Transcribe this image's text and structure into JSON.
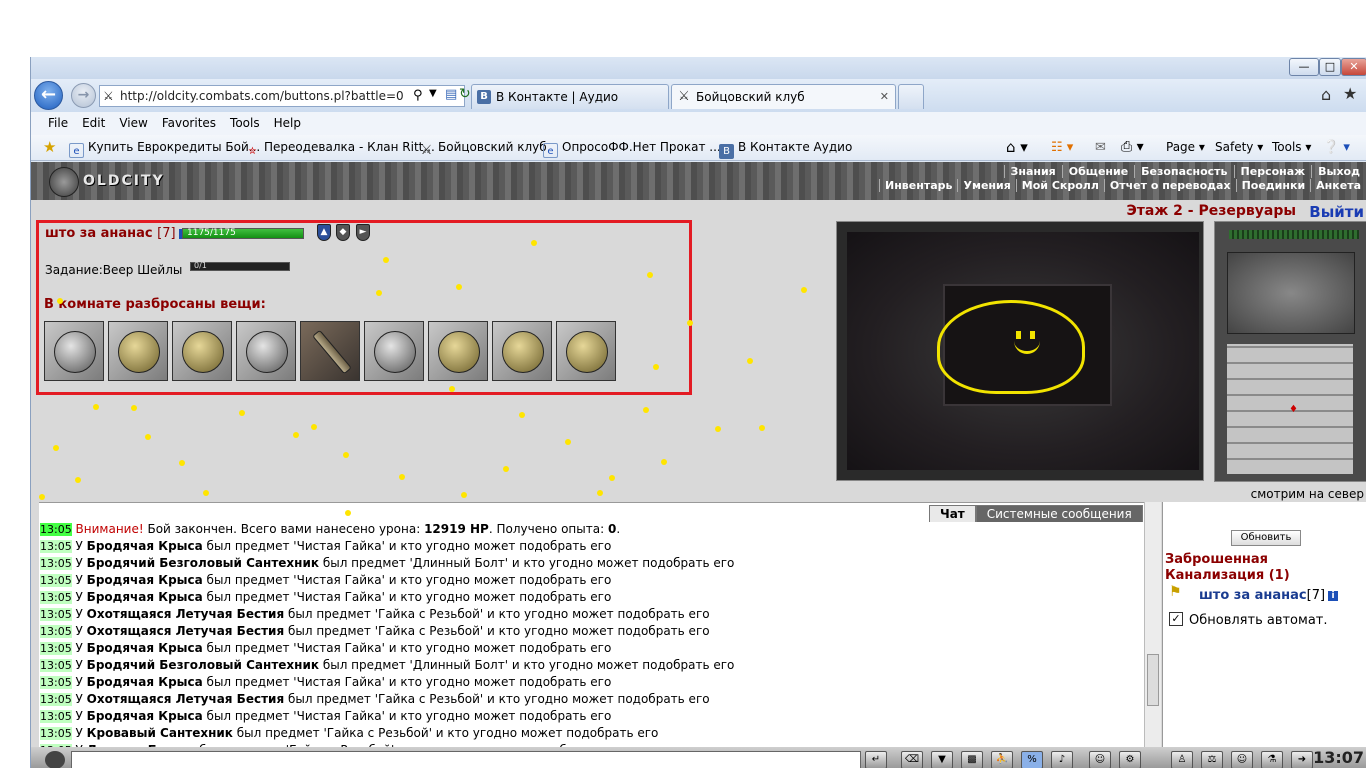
{
  "browser": {
    "address": "http://oldcity.combats.com/buttons.pl?battle=0",
    "tabs": [
      {
        "label": "В Контакте | Аудио",
        "active": false,
        "icon": "vk-icon"
      },
      {
        "label": "Бойцовский клуб",
        "active": true,
        "icon": "swords-icon"
      }
    ],
    "menu": [
      "File",
      "Edit",
      "View",
      "Favorites",
      "Tools",
      "Help"
    ],
    "favorites": [
      {
        "label": "Купить Еврокредиты Бой...",
        "icon": "ie-page-icon"
      },
      {
        "label": "Переодевалка - Клан Ritt...",
        "icon": "clan-icon"
      },
      {
        "label": "Бойцовский клуб",
        "icon": "swords-icon"
      },
      {
        "label": "ОпросоФФ.Нет  Прокат ...",
        "icon": "ie-page-icon"
      },
      {
        "label": "В Контакте  Аудио",
        "icon": "vk-icon"
      }
    ],
    "cmd": {
      "page": "Page",
      "safety": "Safety",
      "tools": "Tools"
    }
  },
  "game": {
    "logo": "OLDCITY",
    "top_menu": [
      "Знания",
      "Общение",
      "Безопасность",
      "Персонаж",
      "Выход"
    ],
    "sub_menu": [
      "Инвентарь",
      "Умения",
      "Мой Скролл",
      "Отчет о переводах",
      "Поединки",
      "Анкета"
    ],
    "player": {
      "name": "што за ананас",
      "level": "[7]",
      "hp_text": "1175/1175",
      "hp_fraction": 1.0
    },
    "task": {
      "label": "Задание:",
      "name": "Веер Шейлы",
      "progress_text": "0/1",
      "progress_fraction": 0
    },
    "loot_header": "В комнате разбросаны вещи:",
    "loot_items": [
      "ring",
      "nut",
      "nut",
      "ring",
      "bolt",
      "ring",
      "nut",
      "nut",
      "nut"
    ],
    "location": "Этаж 2 - Резервуары",
    "exit_label": "Выйти",
    "look_caption": "смотрим на север"
  },
  "chat": {
    "tabs": [
      "Чат",
      "Системные сообщения"
    ],
    "lines": [
      {
        "time": "13:05",
        "alert": true,
        "parts": [
          [
            "r",
            "Внимание!"
          ],
          [
            "n",
            " Бой закончен. Всего вами нанесено урона: "
          ],
          [
            "b",
            "12919 HP"
          ],
          [
            "n",
            ". Получено опыта: "
          ],
          [
            "b",
            "0"
          ],
          [
            "n",
            "."
          ]
        ]
      },
      {
        "time": "13:05",
        "parts": [
          [
            "n",
            "У "
          ],
          [
            "b",
            "Бродячая Крыса"
          ],
          [
            "n",
            " был предмет 'Чистая Гайка' и кто угодно может подобрать его"
          ]
        ]
      },
      {
        "time": "13:05",
        "parts": [
          [
            "n",
            "У "
          ],
          [
            "b",
            "Бродячий Безголовый Сантехник"
          ],
          [
            "n",
            " был предмет 'Длинный Болт' и кто угодно может подобрать его"
          ]
        ]
      },
      {
        "time": "13:05",
        "parts": [
          [
            "n",
            "У "
          ],
          [
            "b",
            "Бродячая Крыса"
          ],
          [
            "n",
            " был предмет 'Чистая Гайка' и кто угодно может подобрать его"
          ]
        ]
      },
      {
        "time": "13:05",
        "parts": [
          [
            "n",
            "У "
          ],
          [
            "b",
            "Бродячая Крыса"
          ],
          [
            "n",
            " был предмет 'Чистая Гайка' и кто угодно может подобрать его"
          ]
        ]
      },
      {
        "time": "13:05",
        "parts": [
          [
            "n",
            "У "
          ],
          [
            "b",
            "Охотящаяся Летучая Бестия"
          ],
          [
            "n",
            " был предмет 'Гайка с Резьбой' и кто угодно может подобрать его"
          ]
        ]
      },
      {
        "time": "13:05",
        "parts": [
          [
            "n",
            "У "
          ],
          [
            "b",
            "Охотящаяся Летучая Бестия"
          ],
          [
            "n",
            " был предмет 'Гайка с Резьбой' и кто угодно может подобрать его"
          ]
        ]
      },
      {
        "time": "13:05",
        "parts": [
          [
            "n",
            "У "
          ],
          [
            "b",
            "Бродячая Крыса"
          ],
          [
            "n",
            " был предмет 'Чистая Гайка' и кто угодно может подобрать его"
          ]
        ]
      },
      {
        "time": "13:05",
        "parts": [
          [
            "n",
            "У "
          ],
          [
            "b",
            "Бродячий Безголовый Сантехник"
          ],
          [
            "n",
            " был предмет 'Длинный Болт' и кто угодно может подобрать его"
          ]
        ]
      },
      {
        "time": "13:05",
        "parts": [
          [
            "n",
            "У "
          ],
          [
            "b",
            "Бродячая Крыса"
          ],
          [
            "n",
            " был предмет 'Чистая Гайка' и кто угодно может подобрать его"
          ]
        ]
      },
      {
        "time": "13:05",
        "parts": [
          [
            "n",
            "У "
          ],
          [
            "b",
            "Охотящаяся Летучая Бестия"
          ],
          [
            "n",
            " был предмет 'Гайка с Резьбой' и кто угодно может подобрать его"
          ]
        ]
      },
      {
        "time": "13:05",
        "parts": [
          [
            "n",
            "У "
          ],
          [
            "b",
            "Бродячая Крыса"
          ],
          [
            "n",
            " был предмет 'Чистая Гайка' и кто угодно может подобрать его"
          ]
        ]
      },
      {
        "time": "13:05",
        "parts": [
          [
            "n",
            "У "
          ],
          [
            "b",
            "Кровавый Сантехник"
          ],
          [
            "n",
            " был предмет 'Гайка с Резьбой' и кто угодно может подобрать его"
          ]
        ]
      },
      {
        "time": "13:05",
        "parts": [
          [
            "n",
            "У "
          ],
          [
            "b",
            "Летучая Бестия"
          ],
          [
            "n",
            " был предмет 'Гайка с Резьбой' и кто угодно может подобрать его"
          ]
        ]
      }
    ]
  },
  "side": {
    "refresh": "Обновить",
    "location": "Заброшенная Канализация (1)",
    "player": "што за ананас",
    "player_level": "[7]",
    "auto_label": "Обновлять автомат.",
    "auto_checked": true
  },
  "clock": "13:07",
  "colors": {
    "accent_red": "#8b0000",
    "link_blue": "#1a3cb3",
    "highlight_box": "#e31b23",
    "time_green": "#c0ffc0"
  }
}
